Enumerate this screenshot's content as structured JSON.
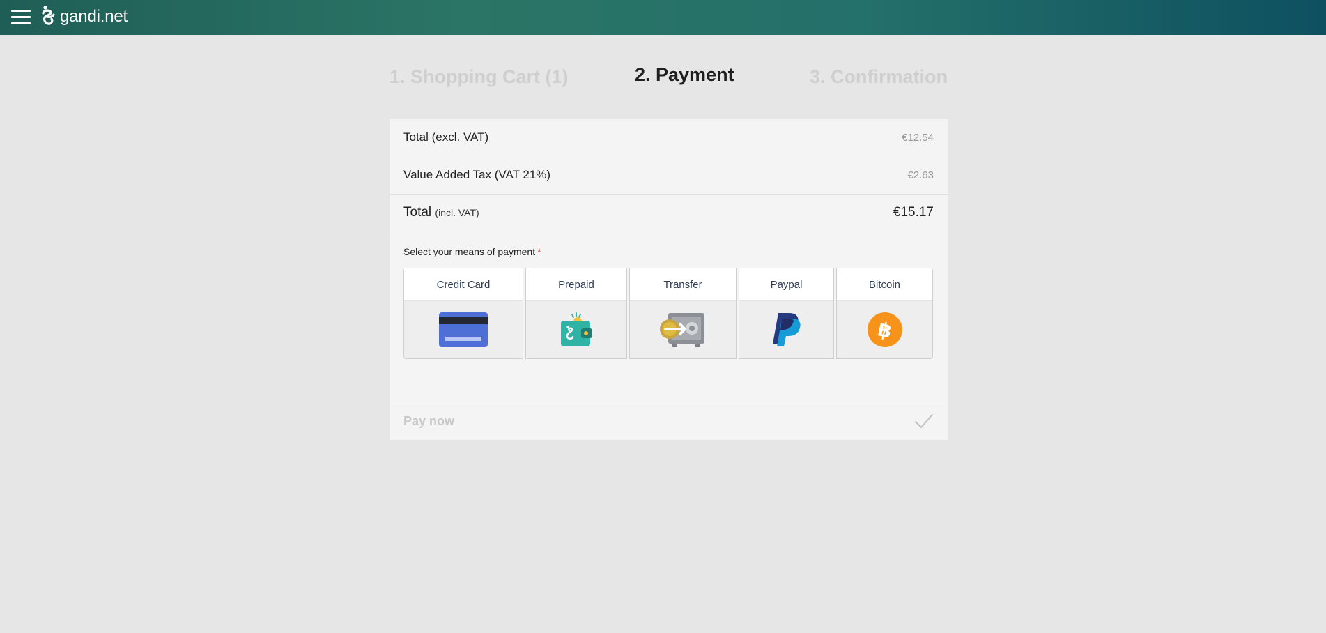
{
  "header": {
    "logo_text": "gandi.net"
  },
  "steps": [
    {
      "label": "1. Shopping Cart (1)",
      "state": "done"
    },
    {
      "label": "2. Payment",
      "state": "active"
    },
    {
      "label": "3. Confirmation",
      "state": "upcoming"
    }
  ],
  "summary": {
    "total_excl": {
      "label": "Total (excl. VAT)",
      "value": "€12.54"
    },
    "vat": {
      "label": "Value Added Tax (VAT 21%)",
      "value": "€2.63"
    },
    "total_incl": {
      "label": "Total",
      "sub": "(incl. VAT)",
      "value": "€15.17"
    }
  },
  "payment": {
    "label": "Select your means of payment",
    "required_mark": "*",
    "methods": [
      {
        "label": "Credit Card",
        "icon": "credit-card-icon"
      },
      {
        "label": "Prepaid",
        "icon": "wallet-icon"
      },
      {
        "label": "Transfer",
        "icon": "safe-transfer-icon"
      },
      {
        "label": "Paypal",
        "icon": "paypal-icon"
      },
      {
        "label": "Bitcoin",
        "icon": "bitcoin-icon"
      }
    ]
  },
  "pay_now": {
    "label": "Pay now"
  },
  "colors": {
    "topbar_start": "#1f5e56",
    "topbar_end": "#0e5060",
    "background": "#e6e6e6",
    "panel": "#f4f4f4",
    "required": "#dd3333"
  }
}
